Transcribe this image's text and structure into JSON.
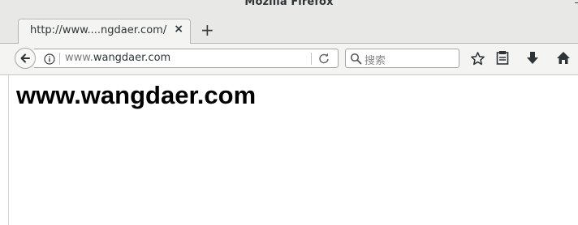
{
  "window": {
    "title": "Mozilla Firefox",
    "close_glyph": "–"
  },
  "tab": {
    "title": "http://www....ngdaer.com/",
    "close_glyph": "×"
  },
  "new_tab_glyph": "+",
  "urlbar": {
    "url_prefix": "www.",
    "url_domain": "wangdaer.com"
  },
  "searchbar": {
    "placeholder": "搜索"
  },
  "toolbar": {
    "icons": [
      "bookmark-star-icon",
      "reading-list-icon",
      "downloads-icon",
      "home-icon"
    ]
  },
  "page": {
    "heading": "www.wangdaer.com"
  }
}
